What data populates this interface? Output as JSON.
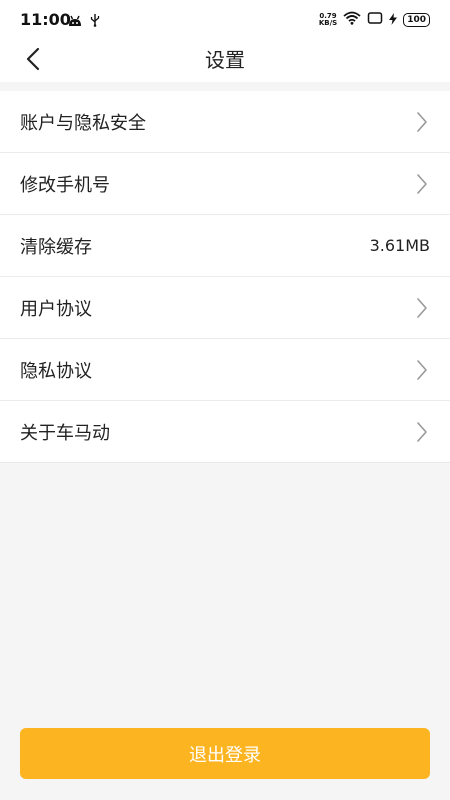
{
  "status_bar": {
    "time": "11:00",
    "net_speed_value": "0.79",
    "net_speed_unit": "KB/S",
    "battery": "100"
  },
  "header": {
    "title": "设置"
  },
  "settings": {
    "items": [
      {
        "label": "账户与隐私安全",
        "value": "",
        "has_arrow": true
      },
      {
        "label": "修改手机号",
        "value": "",
        "has_arrow": true
      },
      {
        "label": "清除缓存",
        "value": "3.61MB",
        "has_arrow": false
      },
      {
        "label": "用户协议",
        "value": "",
        "has_arrow": true
      },
      {
        "label": "隐私协议",
        "value": "",
        "has_arrow": true
      },
      {
        "label": "关于车马动",
        "value": "",
        "has_arrow": true
      }
    ]
  },
  "logout": {
    "label": "退出登录"
  },
  "colors": {
    "accent": "#fdb421",
    "background": "#f5f5f5",
    "divider": "#ececec"
  }
}
